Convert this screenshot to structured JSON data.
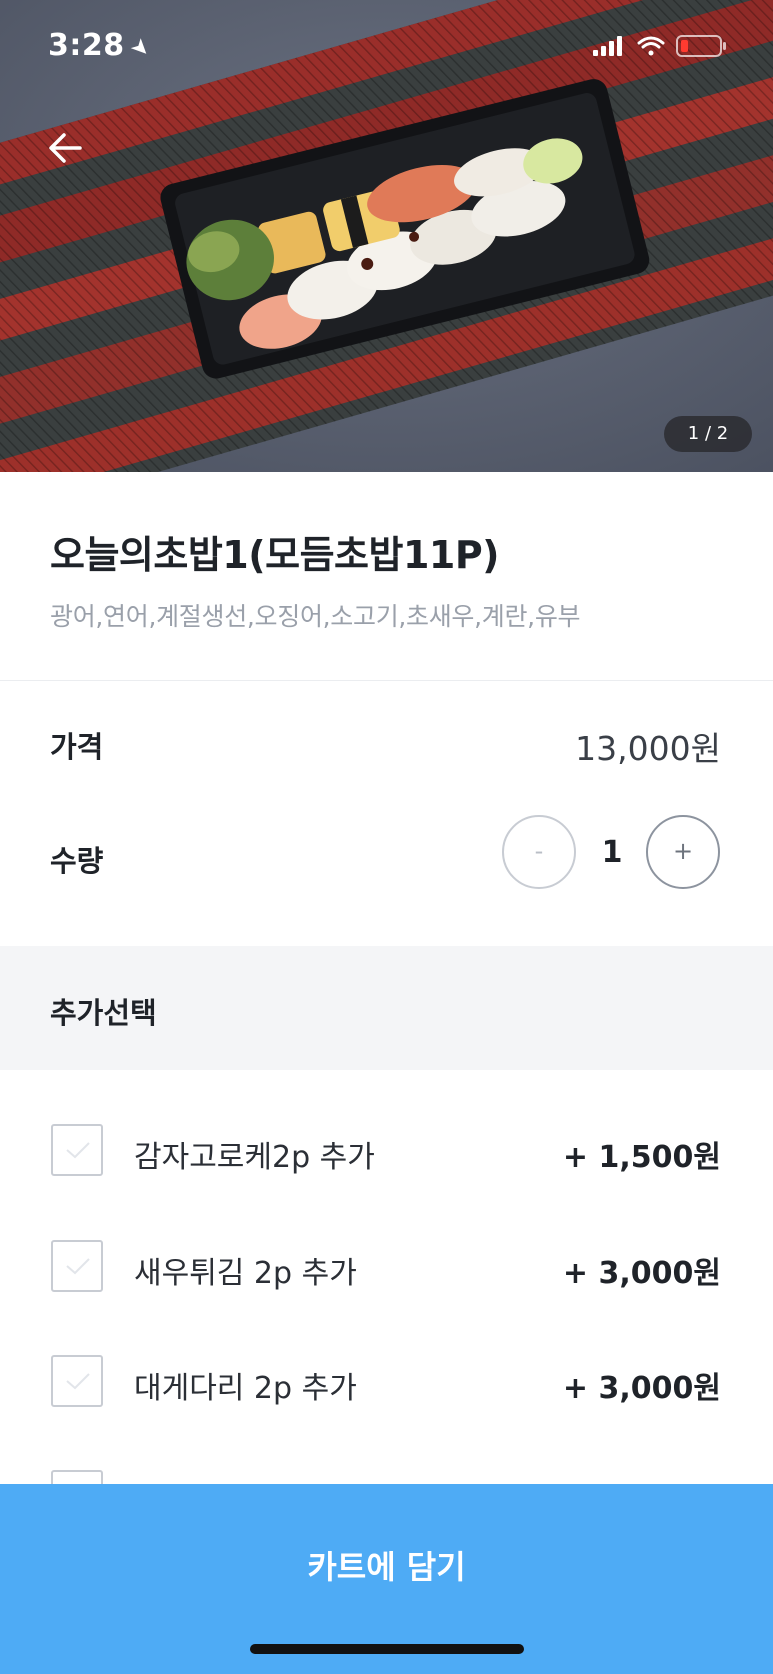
{
  "status_bar": {
    "time": "3:28",
    "location_icon": "location-arrow-icon",
    "signal_icon": "cellular-signal-icon",
    "wifi_icon": "wifi-icon",
    "battery_icon": "battery-low-icon"
  },
  "hero": {
    "page_indicator": "1 / 2",
    "back_icon": "back-arrow-icon"
  },
  "product": {
    "title": "오늘의초밥1(모듬초밥11P)",
    "description": "광어,연어,계절생선,오징어,소고기,초새우,계란,유부"
  },
  "price": {
    "label": "가격",
    "value": "13,000원"
  },
  "quantity": {
    "label": "수량",
    "minus": "-",
    "value": "1",
    "plus": "+"
  },
  "options": {
    "header": "추가선택",
    "items": [
      {
        "label": "감자고로케2p 추가",
        "price": "+ 1,500원"
      },
      {
        "label": "새우튀김 2p 추가",
        "price": "+ 3,000원"
      },
      {
        "label": "대게다리 2p 추가",
        "price": "+ 3,000원"
      }
    ]
  },
  "cart_button": {
    "label": "카트에 담기"
  },
  "colors": {
    "accent": "#4eabf5",
    "section_bg": "#f4f5f7",
    "muted_text": "#9aa0aa"
  }
}
